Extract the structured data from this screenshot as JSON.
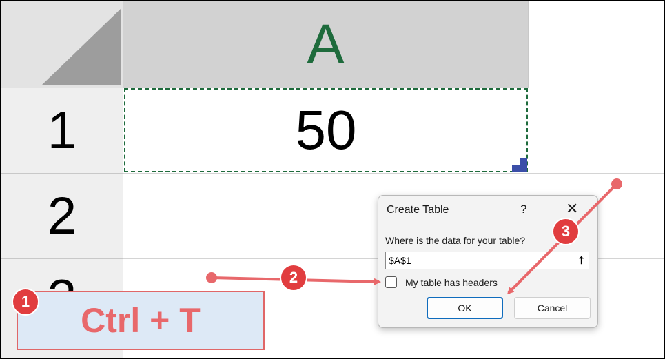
{
  "spreadsheet": {
    "column_header": "A",
    "row_headers": [
      "1",
      "2",
      "3"
    ],
    "cell_a1_value": "50"
  },
  "dialog": {
    "title": "Create Table",
    "help_label": "?",
    "close_label": "✕",
    "prompt_label": "Where is the data for your table?",
    "range_value": "$A$1",
    "collapse_label": "⭡",
    "headers_checkbox_label": "My table has headers",
    "headers_checked": false,
    "ok_label": "OK",
    "cancel_label": "Cancel"
  },
  "annotations": {
    "shortcut_text": "Ctrl + T",
    "step1": "1",
    "step2": "2",
    "step3": "3",
    "accent_color": "#e8686b"
  }
}
